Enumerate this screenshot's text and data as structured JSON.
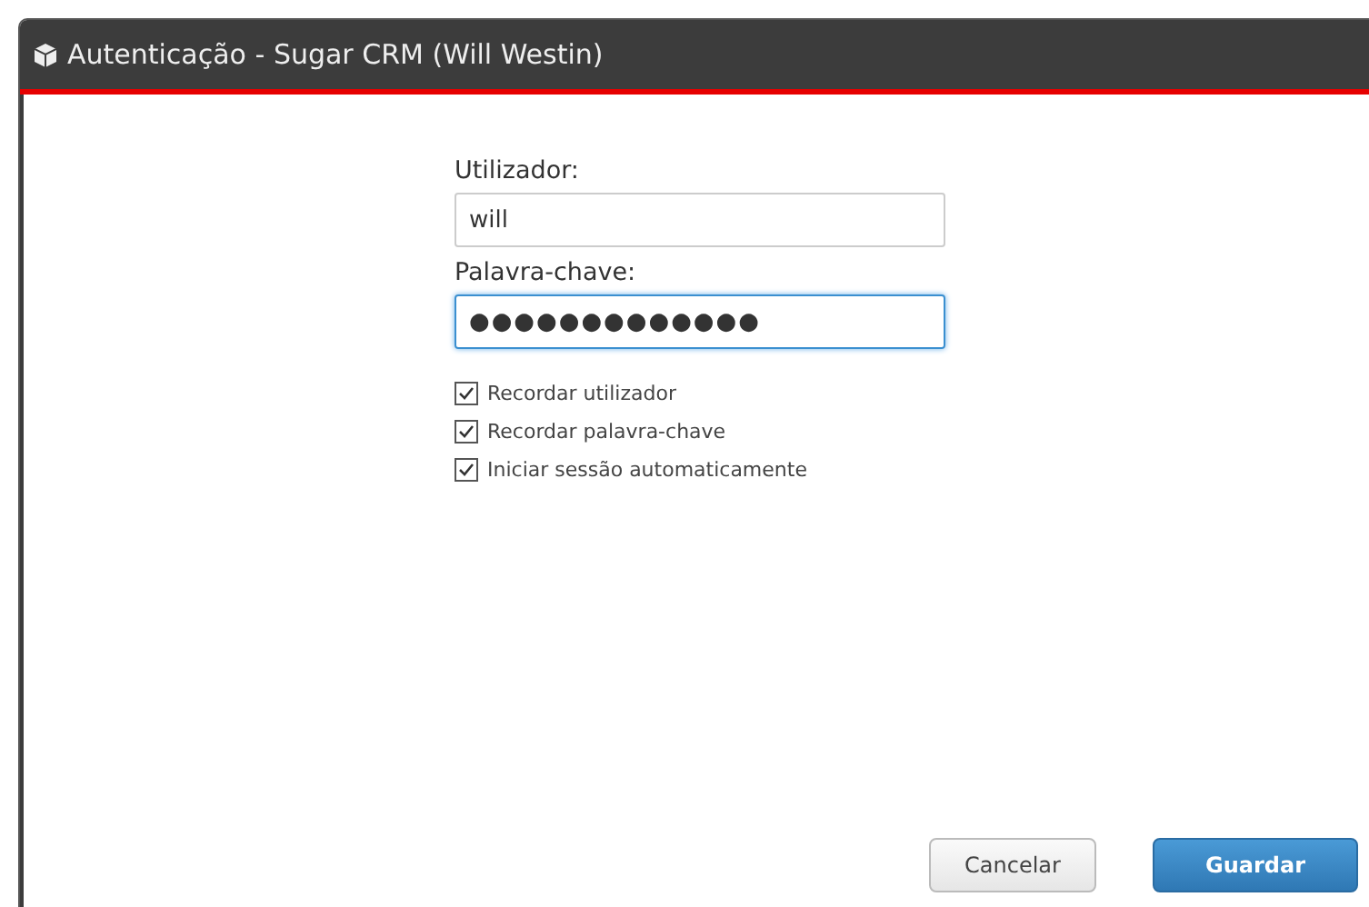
{
  "window": {
    "title": "Autenticação - Sugar CRM (Will Westin)"
  },
  "fields": [
    {
      "label": "Utilizador:",
      "value": "will",
      "focused": false
    },
    {
      "label": "Palavra-chave:",
      "value": "●●●●●●●●●●●●●",
      "focused": true
    }
  ],
  "options": [
    {
      "label": "Recordar utilizador",
      "checked": true
    },
    {
      "label": "Recordar palavra-chave",
      "checked": true
    },
    {
      "label": "Iniciar sessão automaticamente",
      "checked": true
    }
  ],
  "buttons": [
    {
      "label": "Cancelar",
      "kind": "secondary"
    },
    {
      "label": "Guardar",
      "kind": "primary"
    }
  ]
}
